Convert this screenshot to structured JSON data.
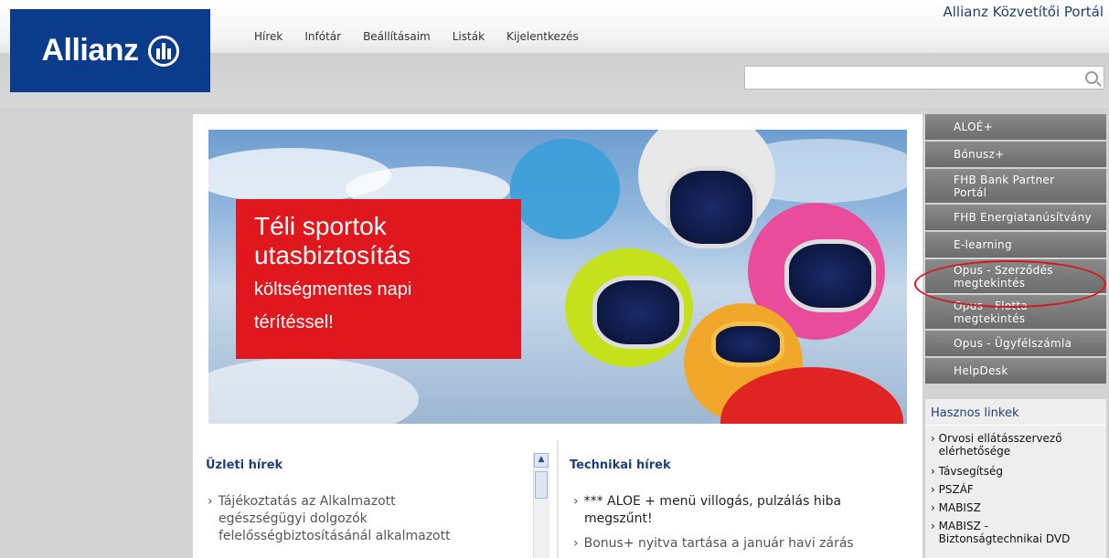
{
  "header": {
    "portal_title": "Allianz Közvetítői Portál",
    "logo_text": "Allianz",
    "nav": [
      "Hírek",
      "Infótár",
      "Beállításaim",
      "Listák",
      "Kijelentkezés"
    ]
  },
  "search": {
    "placeholder": ""
  },
  "banner": {
    "line1": "Téli sportok",
    "line2": "utasbiztosítás",
    "line3": "költségmentes napi",
    "line4": "térítéssel!"
  },
  "business_news": {
    "title": "Üzleti hírek",
    "items": [
      "Tájékoztatás az Alkalmazott",
      "egészségügyi dolgozók",
      "felelősségbiztosításánál alkalmazott"
    ]
  },
  "technical_news": {
    "title": "Technikai hírek",
    "items": [
      "*** ALOE + menü villogás, pulzálás hiba",
      "megszűnt!",
      "Bonus+ nyitva tartása a január havi zárás"
    ]
  },
  "sidebar": {
    "items": [
      {
        "label": "ALOÉ+"
      },
      {
        "label": "Bónusz+"
      },
      {
        "label": "FHB Bank Partner Portál"
      },
      {
        "label": "FHB Energiatanúsítvány"
      },
      {
        "label": "E-learning"
      },
      {
        "label": "Opus - Szerződés megtekintés"
      },
      {
        "label": "Opus - Flotta megtekintés"
      },
      {
        "label": "Opus - Ügyfélszámla"
      },
      {
        "label": "HelpDesk"
      }
    ]
  },
  "useful_links": {
    "title": "Hasznos linkek",
    "items": [
      "Orvosi ellátásszervező elérhetősége",
      "Távsegítség",
      "PSZÁF",
      "MABISZ",
      "MABISZ - Biztonságtechnikai DVD"
    ]
  },
  "colors": {
    "brand_blue": "#0b3c8c",
    "accent_red": "#e0171d",
    "sidebar_gray": "#7a7a7a"
  }
}
